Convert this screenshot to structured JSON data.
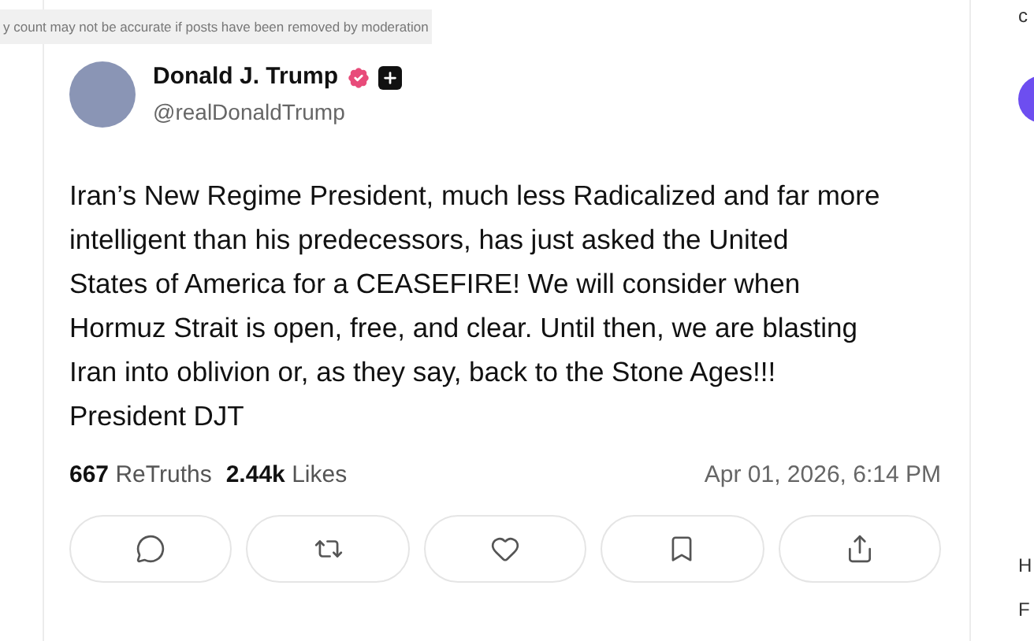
{
  "tooltip": {
    "text": "y count may not be accurate if posts have been removed by moderation"
  },
  "post": {
    "author": {
      "name": "Donald J. Trump",
      "handle": "@realDonaldTrump",
      "verified": true
    },
    "body": "Iran’s New Regime President, much less Radicalized and far more\nintelligent than his predecessors, has just asked the United\nStates of America for a CEASEFIRE! We will consider when\nHormuz Strait is open, free, and clear. Until then, we are blasting\nIran into oblivion or, as they say, back to the Stone Ages!!!\nPresident DJT",
    "stats": [
      {
        "count": "667",
        "label": "ReTruths"
      },
      {
        "count": "2.44k",
        "label": "Likes"
      }
    ],
    "timestamp": "Apr 01, 2026, 6:14 PM",
    "actions": [
      {
        "kind": "reply"
      },
      {
        "kind": "retruth"
      },
      {
        "kind": "like"
      },
      {
        "kind": "bookmark"
      },
      {
        "kind": "share"
      }
    ]
  },
  "sidebar": {
    "fragments": [
      "c",
      "H",
      "F"
    ]
  }
}
